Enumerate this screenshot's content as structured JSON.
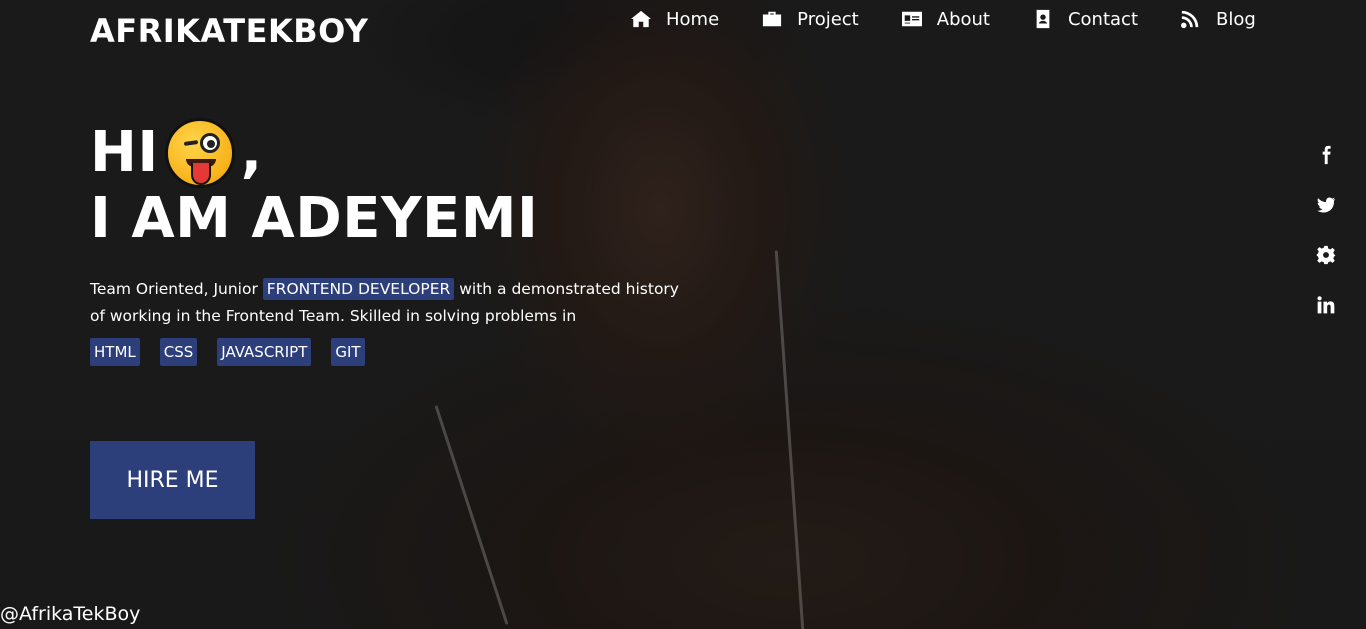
{
  "brand": "AFRIKATEKBOY",
  "nav": [
    {
      "label": "Home",
      "icon": "home-icon"
    },
    {
      "label": "Project",
      "icon": "briefcase-icon"
    },
    {
      "label": "About",
      "icon": "id-card-icon"
    },
    {
      "label": "Contact",
      "icon": "contact-book-icon"
    },
    {
      "label": "Blog",
      "icon": "blog-feed-icon"
    }
  ],
  "hero": {
    "greeting": "HI",
    "comma": ",",
    "emoji": "winking-face-with-tongue",
    "name_line": "I AM ADEYEMI",
    "intro_part1": "Team Oriented, Junior",
    "role": "FRONTEND DEVELOPER",
    "intro_part2": "with a demonstrated history of working in the Frontend Team. Skilled in solving problems in",
    "skills": [
      "HTML",
      "CSS",
      "JAVASCRIPT",
      "GIT"
    ],
    "cta": "HIRE ME"
  },
  "social": [
    "facebook-icon",
    "twitter-icon",
    "gear-icon",
    "linkedin-icon"
  ],
  "handle": "@AfrikaTekBoy",
  "colors": {
    "background": "#1e1e1e",
    "accent": "#2d3f7a",
    "text": "#ffffff"
  }
}
